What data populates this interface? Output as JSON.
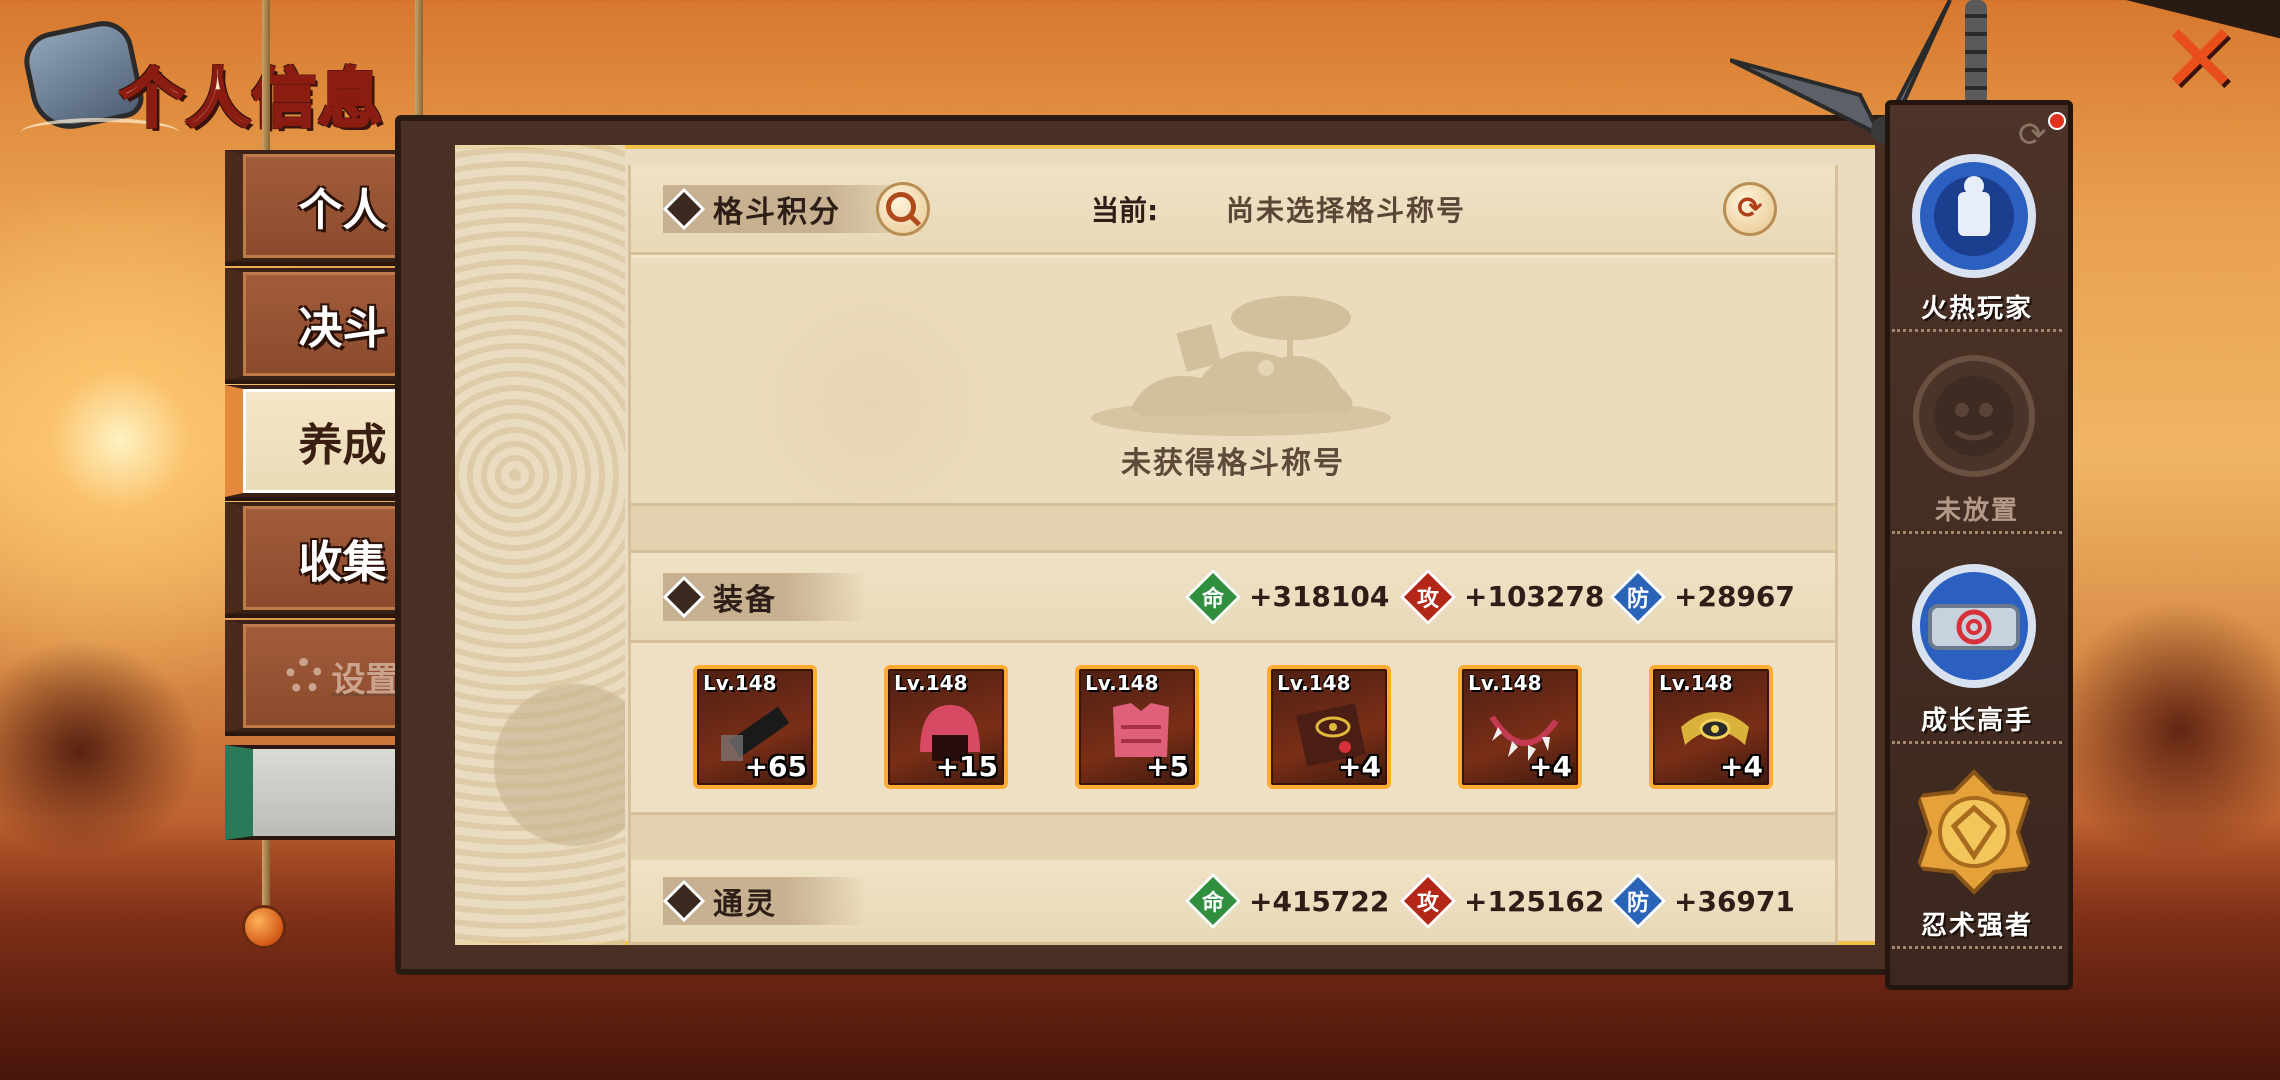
{
  "header": {
    "title": "个人信息",
    "close_icon": "close-x-icon"
  },
  "menu": {
    "items": [
      {
        "label": "个人",
        "state": "normal"
      },
      {
        "label": "决斗",
        "state": "normal"
      },
      {
        "label": "养成",
        "state": "active"
      },
      {
        "label": "收集",
        "state": "normal"
      },
      {
        "label": "设置",
        "state": "disabled"
      }
    ]
  },
  "fight_points": {
    "section_label": "格斗积分",
    "current_label": "当前:",
    "current_value": "尚未选择格斗称号",
    "empty_text": "未获得格斗称号"
  },
  "equipment": {
    "section_label": "装备",
    "stats": {
      "hp_badge": "命",
      "hp": "+318104",
      "atk_badge": "攻",
      "atk": "+103278",
      "def_badge": "防",
      "def": "+28967"
    },
    "items": [
      {
        "level": "Lv.148",
        "plus": "+65",
        "icon": "blade-weapon-icon"
      },
      {
        "level": "Lv.148",
        "plus": "+15",
        "icon": "red-helmet-icon"
      },
      {
        "level": "Lv.148",
        "plus": "+5",
        "icon": "red-armor-icon"
      },
      {
        "level": "Lv.148",
        "plus": "+4",
        "icon": "scroll-book-icon"
      },
      {
        "level": "Lv.148",
        "plus": "+4",
        "icon": "claw-necklace-icon"
      },
      {
        "level": "Lv.148",
        "plus": "+4",
        "icon": "golden-belt-icon"
      }
    ]
  },
  "summon": {
    "section_label": "通灵",
    "stats": {
      "hp_badge": "命",
      "hp": "+415722",
      "atk_badge": "攻",
      "atk": "+125162",
      "def_badge": "防",
      "def": "+36971"
    }
  },
  "sidebar": {
    "badges": [
      {
        "label": "火热玩家",
        "icon": "hot-player-badge-icon",
        "dim": false
      },
      {
        "label": "未放置",
        "icon": "empty-slot-badge-icon",
        "dim": true
      },
      {
        "label": "成长高手",
        "icon": "leaf-headband-badge-icon",
        "dim": false
      },
      {
        "label": "忍术强者",
        "icon": "golden-emblem-badge-icon",
        "dim": false
      }
    ]
  },
  "colors": {
    "accent_gold": "#f0c24a",
    "hp_green": "#2f8f3e",
    "atk_red": "#b32718",
    "def_blue": "#2a64b8",
    "item_border": "#ffaa33"
  }
}
